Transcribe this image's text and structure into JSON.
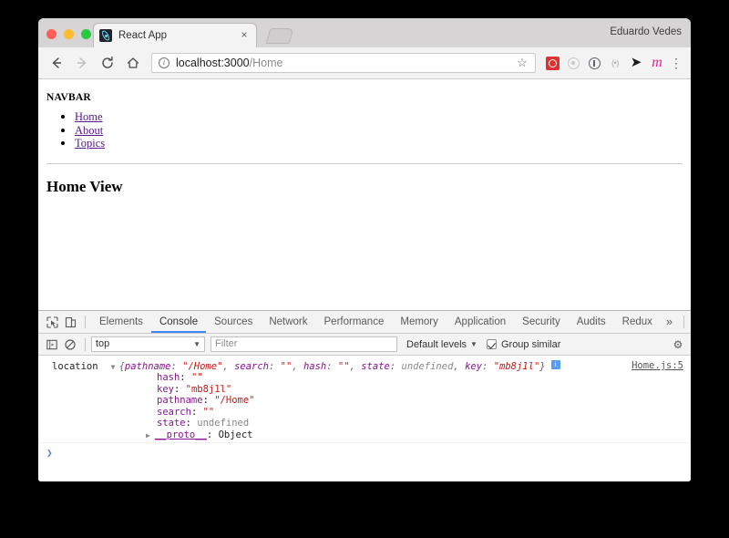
{
  "browser": {
    "profile_name": "Eduardo Vedes",
    "tab": {
      "title": "React App",
      "close_label": "×",
      "favicon": "react-logo-favicon"
    },
    "new_tab_label": "new-tab-button",
    "toolbar": {
      "back_icon": "back-arrow-icon",
      "forward_icon": "forward-arrow-icon",
      "reload_icon": "reload-icon",
      "home_icon": "home-icon",
      "site_info_icon": "info-circle-icon",
      "url_host": "localhost:3000",
      "url_path": "/Home",
      "bookmark_star": "☆",
      "extensions": [
        {
          "name": "redux-devtools-extension-icon",
          "color": "#e03131"
        },
        {
          "name": "circle-extension-icon",
          "color": "#c8c8c8"
        },
        {
          "name": "exclamation-extension-icon",
          "color": "#5f6368"
        },
        {
          "name": "parentheses-extension-icon",
          "label": "(•)"
        },
        {
          "name": "pocket-extension-icon",
          "label": "➤"
        },
        {
          "name": "mercury-extension-icon",
          "label": "m",
          "color": "#e91e8c"
        }
      ],
      "chrome_menu_icon": "⋮"
    }
  },
  "page": {
    "navbar_heading": "NAVBAR",
    "nav_links": [
      {
        "label": "Home",
        "name": "nav-link-home"
      },
      {
        "label": "About",
        "name": "nav-link-about"
      },
      {
        "label": "Topics",
        "name": "nav-link-topics"
      }
    ],
    "view_heading": "Home View"
  },
  "devtools": {
    "inspect_icon": "inspect-element-icon",
    "device_toolbar_icon": "device-toolbar-icon",
    "tabs": [
      {
        "label": "Elements",
        "active": false
      },
      {
        "label": "Console",
        "active": true
      },
      {
        "label": "Sources",
        "active": false
      },
      {
        "label": "Network",
        "active": false
      },
      {
        "label": "Performance",
        "active": false
      },
      {
        "label": "Memory",
        "active": false
      },
      {
        "label": "Application",
        "active": false
      },
      {
        "label": "Security",
        "active": false
      },
      {
        "label": "Audits",
        "active": false
      },
      {
        "label": "Redux",
        "active": false
      }
    ],
    "more_tabs_label": "»",
    "vertical_dots_label": "⋮",
    "close_label": "✕",
    "console_toolbar": {
      "sidebar_toggle_icon": "console-sidebar-icon",
      "clear_icon": "clear-console-icon",
      "context_value": "top",
      "context_caret": "▼",
      "filter_placeholder": "Filter",
      "filter_value": "",
      "levels_label": "Default levels",
      "levels_caret": "▼",
      "group_similar_label": "Group similar",
      "group_similar_checked": true,
      "settings_icon": "⚙"
    },
    "console": {
      "entry_label": "location",
      "disclosure": "▼",
      "preview": {
        "open_brace": "{",
        "close_brace": "}",
        "parts": [
          {
            "key": "pathname",
            "value": "\"/Home\"",
            "type": "string"
          },
          {
            "key": "search",
            "value": "\"\"",
            "type": "string"
          },
          {
            "key": "hash",
            "value": "\"\"",
            "type": "string"
          },
          {
            "key": "state",
            "value": "undefined",
            "type": "undefined"
          },
          {
            "key": "key",
            "value": "\"mb8j1l\"",
            "type": "string"
          }
        ]
      },
      "info_badge": "i",
      "source_link": "Home.js:5",
      "properties": [
        {
          "key": "hash",
          "value": "\"\"",
          "type": "string"
        },
        {
          "key": "key",
          "value": "\"mb8j1l\"",
          "type": "string"
        },
        {
          "key": "pathname",
          "value": "\"/Home\"",
          "type": "string"
        },
        {
          "key": "search",
          "value": "\"\"",
          "type": "string"
        },
        {
          "key": "state",
          "value": "undefined",
          "type": "undefined"
        }
      ],
      "proto": {
        "triangle": "▶",
        "name": "__proto__",
        "value": "Object"
      },
      "prompt_chevron": "❯"
    }
  }
}
